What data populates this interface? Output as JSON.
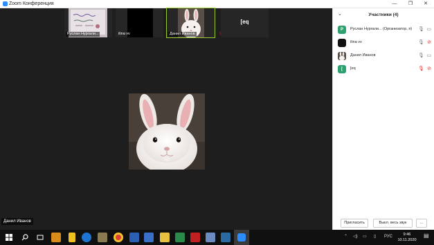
{
  "window": {
    "title": "Zoom Конференция",
    "controls": [
      "—",
      "❐",
      "✕"
    ]
  },
  "thumbnails": [
    {
      "name": "Руслан Нургали..."
    },
    {
      "name": "ilina vv"
    },
    {
      "name": "Данил Иванов"
    },
    {
      "name": "[eq"
    }
  ],
  "main": {
    "speaker_name": "Данил Иванов"
  },
  "participants_panel": {
    "title": "Участники (4)",
    "items": [
      {
        "avatar_letter": "Р",
        "avatar_color": "#2e9f6e",
        "name": "Руслан Нургали... (Организатор, я)",
        "mic": "on",
        "video": "on"
      },
      {
        "avatar_letter": "",
        "avatar_color": "#111111",
        "name": "ilina vv",
        "mic": "on",
        "video": "off"
      },
      {
        "avatar_letter": "",
        "avatar_color": "#8a7a70",
        "name": "Данил Иванов",
        "mic": "on",
        "video": "on"
      },
      {
        "avatar_letter": "[",
        "avatar_color": "#2e9f6e",
        "name": "[eq",
        "mic": "muted",
        "video": "off"
      }
    ],
    "invite_label": "Пригласить",
    "mute_all_label": "Выкл. весь звук",
    "more_label": "..."
  },
  "taskbar": {
    "lang": "РУС",
    "time": "9:46",
    "date": "10.11.2020"
  },
  "colors": {
    "meeting_bg": "#1e1e1e",
    "zoom_blue": "#2d8cff",
    "muted_red": "#e33333",
    "active_speaker": "#9acd32"
  }
}
